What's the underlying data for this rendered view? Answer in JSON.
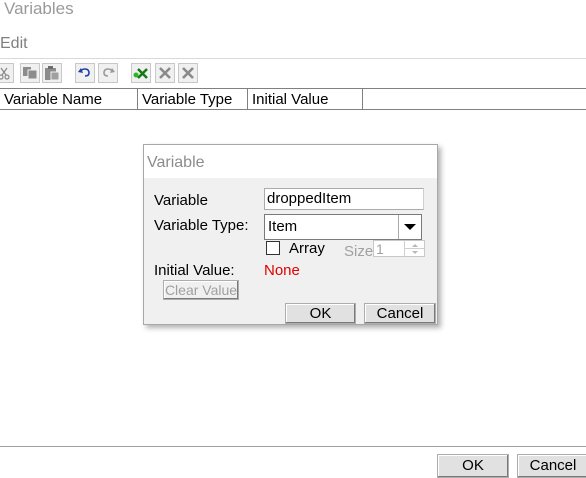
{
  "window": {
    "title": "Variables"
  },
  "menu": {
    "edit": "Edit"
  },
  "toolbar": {
    "buttons": [
      "cut-icon",
      "copy-icon",
      "paste-icon",
      "undo-icon",
      "redo-icon",
      "add-variable-icon",
      "delete-icon",
      "delete-all-icon"
    ]
  },
  "table": {
    "columns": [
      "Variable Name",
      "Variable Type",
      "Initial Value"
    ],
    "rows": []
  },
  "dialog": {
    "title": "Variable",
    "variable_label": "Variable",
    "variable_value": "droppedItem",
    "type_label": "Variable Type:",
    "type_value": "Item",
    "array_label": "Array",
    "size_label": "Size",
    "size_value": "1",
    "initial_label": "Initial Value:",
    "initial_value": "None",
    "initial_value_color": "#e00000",
    "clear_label": "Clear Value",
    "ok_label": "OK",
    "cancel_label": "Cancel"
  },
  "footer": {
    "ok_label": "OK",
    "cancel_label": "Cancel"
  }
}
